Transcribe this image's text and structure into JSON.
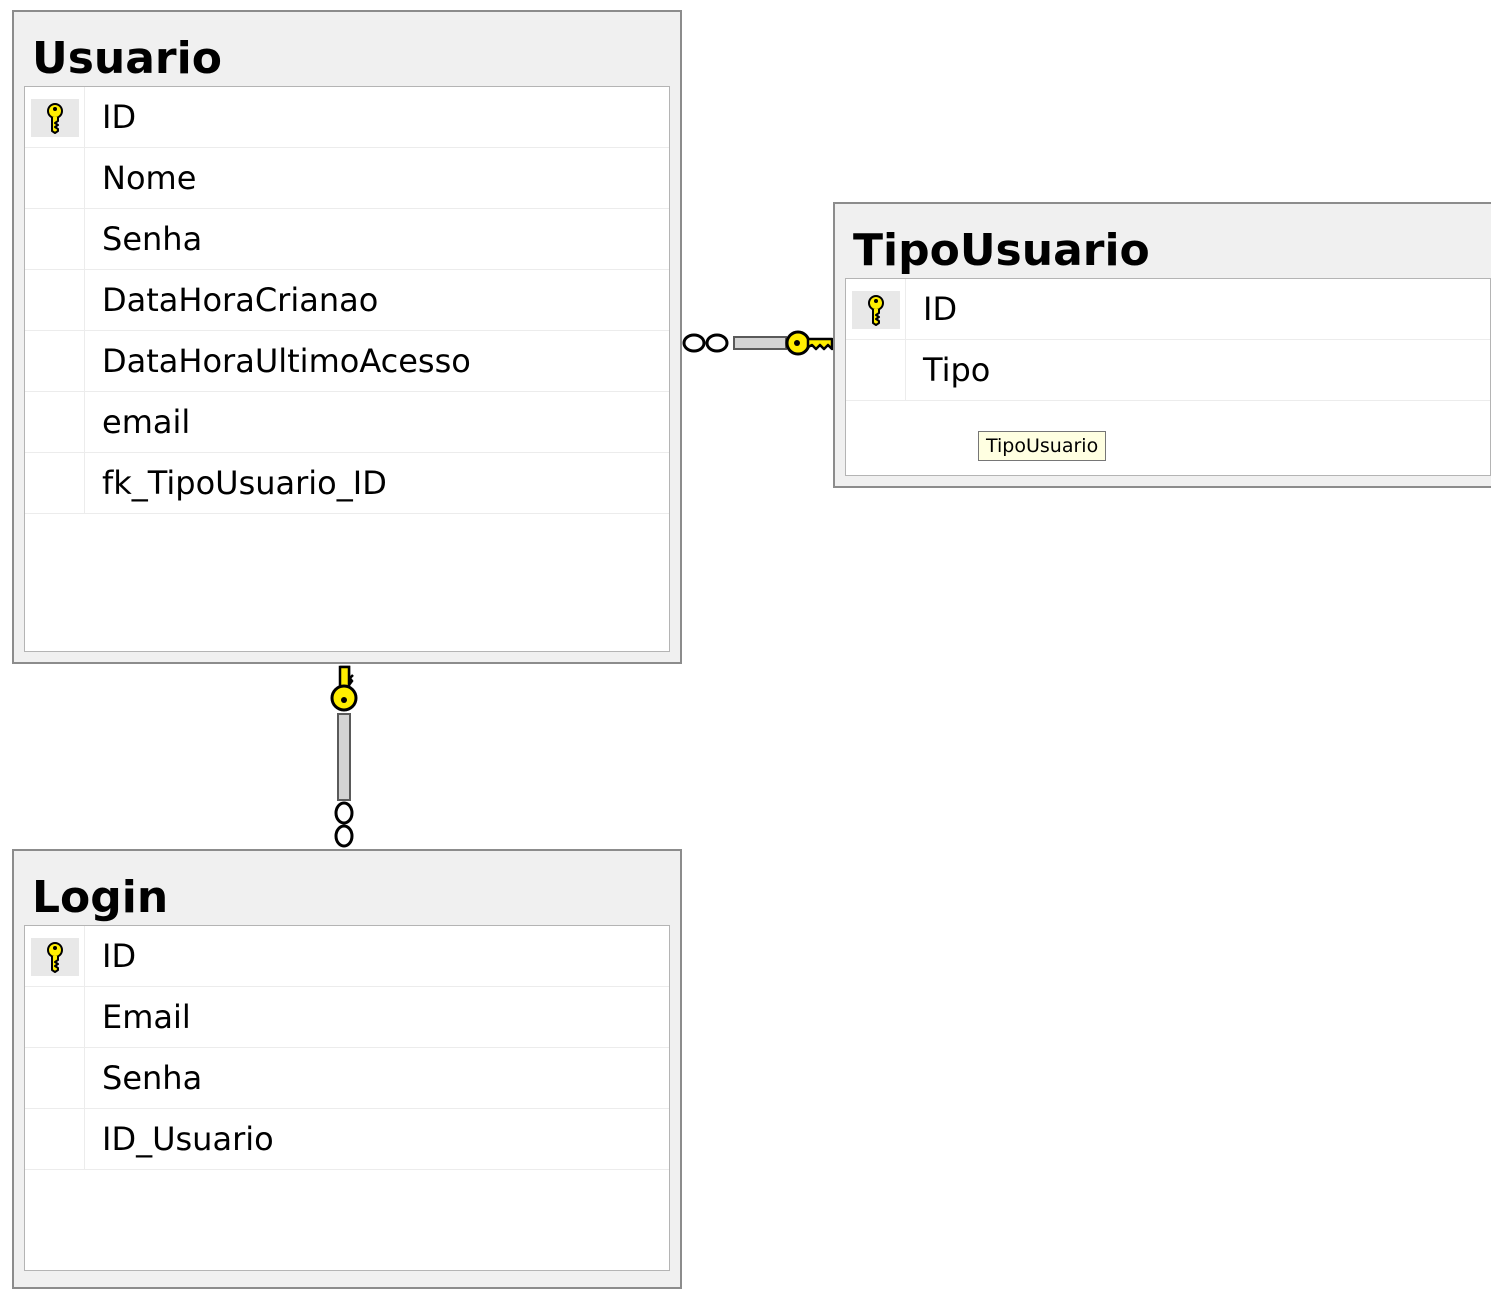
{
  "tables": {
    "usuario": {
      "title": "Usuario",
      "columns": [
        {
          "name": "ID",
          "primary_key": true
        },
        {
          "name": "Nome",
          "primary_key": false
        },
        {
          "name": "Senha",
          "primary_key": false
        },
        {
          "name": "DataHoraCrianao",
          "primary_key": false
        },
        {
          "name": "DataHoraUltimoAcesso",
          "primary_key": false
        },
        {
          "name": "email",
          "primary_key": false
        },
        {
          "name": "fk_TipoUsuario_ID",
          "primary_key": false
        }
      ]
    },
    "tipousuario": {
      "title": "TipoUsuario",
      "columns": [
        {
          "name": "ID",
          "primary_key": true
        },
        {
          "name": "Tipo",
          "primary_key": false
        }
      ],
      "tooltip": "TipoUsuario"
    },
    "login": {
      "title": "Login",
      "columns": [
        {
          "name": "ID",
          "primary_key": true
        },
        {
          "name": "Email",
          "primary_key": false
        },
        {
          "name": "Senha",
          "primary_key": false
        },
        {
          "name": "ID_Usuario",
          "primary_key": false
        }
      ]
    }
  },
  "relationships": [
    {
      "from": "usuario",
      "to": "tipousuario",
      "one_end": "tipousuario",
      "many_end": "usuario"
    },
    {
      "from": "usuario",
      "to": "login",
      "one_end": "usuario",
      "many_end": "login"
    }
  ],
  "colors": {
    "key_yellow": "#ffee00",
    "table_header_bg": "#f0f0f0",
    "tooltip_bg": "#ffffe1"
  }
}
